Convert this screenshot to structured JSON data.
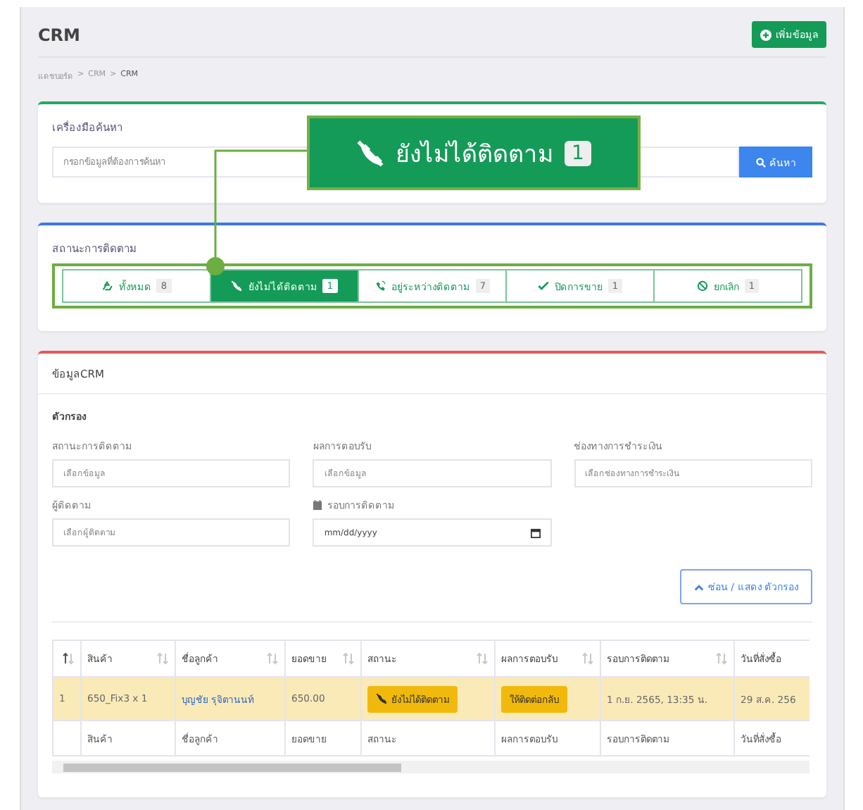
{
  "page": {
    "title": "CRM",
    "add_button": "เพิ่มข้อมูล",
    "breadcrumb": [
      "แดชบอร์ด",
      "CRM",
      "CRM"
    ],
    "breadcrumb_separator": ">"
  },
  "search": {
    "title": "เครื่องมือค้นหา",
    "placeholder": "กรอกข้อมูลที่ต้องการค้นหา",
    "button": "ค้นหา"
  },
  "callout": {
    "label": "ยังไม่ได้ติดตาม",
    "count": "1"
  },
  "status": {
    "title": "สถานะการติดตาม",
    "tabs": [
      {
        "kind": "all",
        "label": "ทั้งหมด",
        "count": "8",
        "selected": false
      },
      {
        "kind": "pending",
        "label": "ยังไม่ได้ติดตาม",
        "count": "1",
        "selected": true
      },
      {
        "kind": "following",
        "label": "อยู่ระหว่างติดตาม",
        "count": "7",
        "selected": false
      },
      {
        "kind": "closed",
        "label": "ปิดการขาย",
        "count": "1",
        "selected": false
      },
      {
        "kind": "cancelled",
        "label": "ยกเลิก",
        "count": "1",
        "selected": false
      }
    ]
  },
  "data": {
    "title": "ข้อมูลCRM",
    "filter_title": "ตัวกรอง",
    "filters": [
      {
        "kind": "select",
        "label": "สถานะการติดตาม",
        "placeholder": "เลือกข้อมูล"
      },
      {
        "kind": "select",
        "label": "ผลการตอบรับ",
        "placeholder": "เลือกข้อมูล"
      },
      {
        "kind": "select",
        "label": "ช่องทางการชำระเงิน",
        "placeholder": "เลือกช่องทางการชำระเงิน"
      },
      {
        "kind": "select",
        "label": "ผู้ติดตาม",
        "placeholder": "เลือกผู้ติดตาม"
      },
      {
        "kind": "date",
        "label": "รอบการติดตาม",
        "placeholder": "mm/dd/yyyy"
      }
    ],
    "toggle_button": "ซ่อน / แสดง ตัวกรอง",
    "table": {
      "columns": [
        {
          "sorted": true
        },
        {
          "label": "สินค้า",
          "sorted": false
        },
        {
          "label": "ชื่อลูกค้า",
          "sorted": false
        },
        {
          "label": "ยอดขาย",
          "sorted": false
        },
        {
          "label": "สถานะ",
          "sorted": false
        },
        {
          "label": "ผลการตอบรับ",
          "sorted": false
        },
        {
          "label": "รอบการติดตาม",
          "sorted": false
        },
        {
          "label": "วันที่สั่งซื้อ"
        }
      ],
      "rows": [
        {
          "highlighted": true,
          "cells": [
            {
              "kind": "text",
              "text": "1"
            },
            {
              "kind": "text",
              "text": "650_Fix3 x 1"
            },
            {
              "kind": "link",
              "text": "บุญชัย รุจิตานนท์"
            },
            {
              "kind": "text",
              "text": "650.00"
            },
            {
              "kind": "status",
              "text": "ยังไม่ได้ติดตาม"
            },
            {
              "kind": "badge",
              "text": "ให้ติดต่อกลับ"
            },
            {
              "kind": "text",
              "text": "1 ก.ย. 2565, 13:35 น."
            },
            {
              "kind": "text",
              "text": "29 ส.ค. 256"
            }
          ]
        }
      ],
      "footer": [
        "สินค้า",
        "ชื่อลูกค้า",
        "ยอดขาย",
        "สถานะ",
        "ผลการตอบรับ",
        "รอบการติดตาม",
        "วันที่สั่งซื้อ"
      ]
    }
  }
}
